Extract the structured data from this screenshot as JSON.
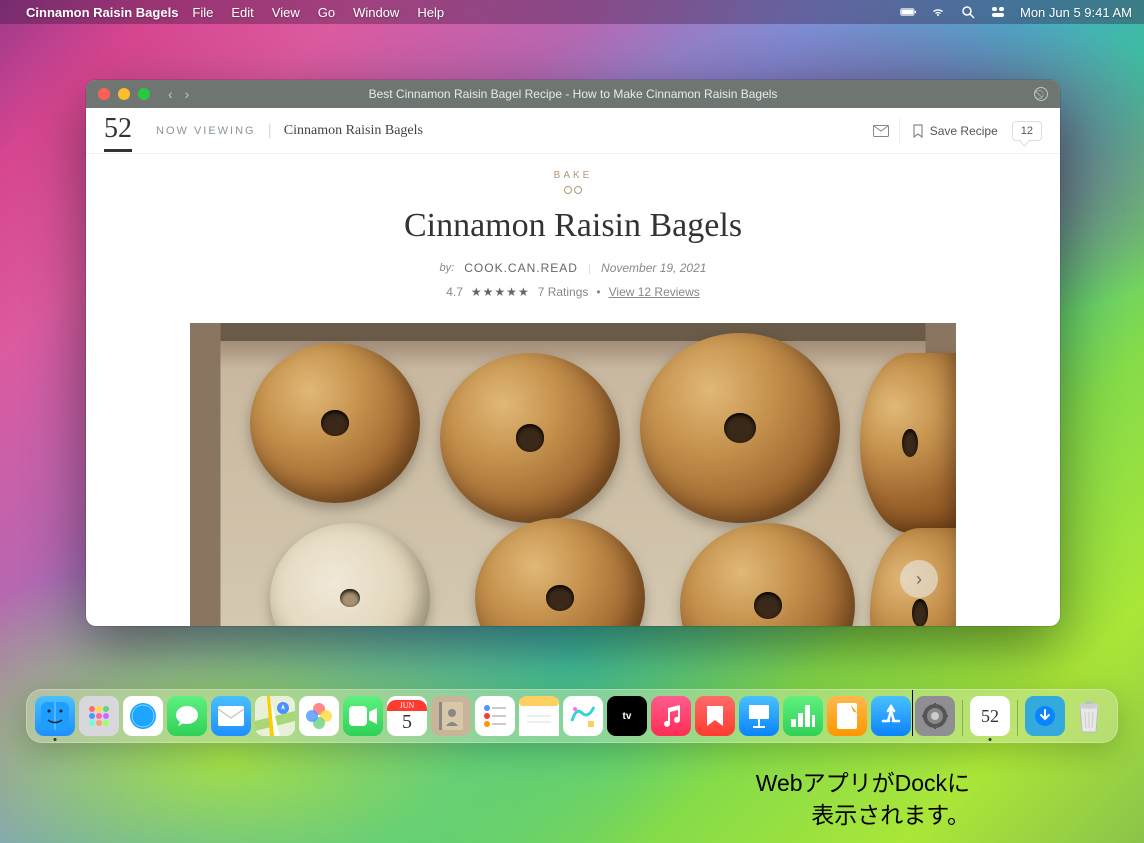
{
  "menubar": {
    "app_name": "Cinnamon Raisin Bagels",
    "items": [
      "File",
      "Edit",
      "View",
      "Go",
      "Window",
      "Help"
    ],
    "clock": "Mon Jun 5  9:41 AM"
  },
  "window": {
    "title": "Best Cinnamon Raisin Bagel Recipe - How to Make Cinnamon Raisin Bagels"
  },
  "page": {
    "logo": "52",
    "now_viewing_label": "NOW VIEWING",
    "breadcrumb": "Cinnamon Raisin Bagels",
    "save_label": "Save Recipe",
    "comment_count": "12",
    "category": "BAKE",
    "title": "Cinnamon Raisin Bagels",
    "by_label": "by:",
    "author": "COOK.CAN.READ",
    "date": "November 19, 2021",
    "rating_value": "4.7",
    "stars": "★★★★★",
    "rating_count": "7 Ratings",
    "reviews_link": "View 12 Reviews"
  },
  "dock": {
    "apps": [
      {
        "name": "finder",
        "color": "#1e8fff",
        "glyph": "☺"
      },
      {
        "name": "launchpad",
        "color": "#e8e8e8",
        "glyph": "⊞"
      },
      {
        "name": "safari",
        "color": "#1ea5ff",
        "glyph": "◎"
      },
      {
        "name": "messages",
        "color": "#30d158",
        "glyph": "✉"
      },
      {
        "name": "mail",
        "color": "#1e8fff",
        "glyph": "✉"
      },
      {
        "name": "maps",
        "color": "#f0f0f0",
        "glyph": "➴"
      },
      {
        "name": "photos",
        "color": "#fff",
        "glyph": "✿"
      },
      {
        "name": "facetime",
        "color": "#30d158",
        "glyph": "▢"
      },
      {
        "name": "calendar",
        "color": "#fff",
        "glyph": "5"
      },
      {
        "name": "contacts",
        "color": "#c8b090",
        "glyph": "☰"
      },
      {
        "name": "reminders",
        "color": "#fff",
        "glyph": "☰"
      },
      {
        "name": "notes",
        "color": "#ffd060",
        "glyph": ""
      },
      {
        "name": "freeform",
        "color": "#fff",
        "glyph": "∿"
      },
      {
        "name": "tv",
        "color": "#000",
        "glyph": "tv"
      },
      {
        "name": "music",
        "color": "#ff2d55",
        "glyph": "♪"
      },
      {
        "name": "news",
        "color": "#ff3b30",
        "glyph": "N"
      },
      {
        "name": "keynote",
        "color": "#0a84ff",
        "glyph": "▭"
      },
      {
        "name": "numbers",
        "color": "#30d158",
        "glyph": "▥"
      },
      {
        "name": "pages",
        "color": "#ff9500",
        "glyph": "✎"
      },
      {
        "name": "appstore",
        "color": "#0a84ff",
        "glyph": "A"
      },
      {
        "name": "settings",
        "color": "#8e8e93",
        "glyph": "⚙"
      }
    ],
    "extras": [
      {
        "name": "52-webapp",
        "color": "#fff",
        "glyph": "52"
      },
      {
        "name": "downloads",
        "color": "#34aadc",
        "glyph": "↓"
      },
      {
        "name": "trash",
        "color": "#e0e0e0",
        "glyph": "🗑"
      }
    ],
    "calendar_month": "JUN",
    "calendar_day": "5"
  },
  "annotation": {
    "line1": "WebアプリがDockに",
    "line2": "表示されます。"
  }
}
